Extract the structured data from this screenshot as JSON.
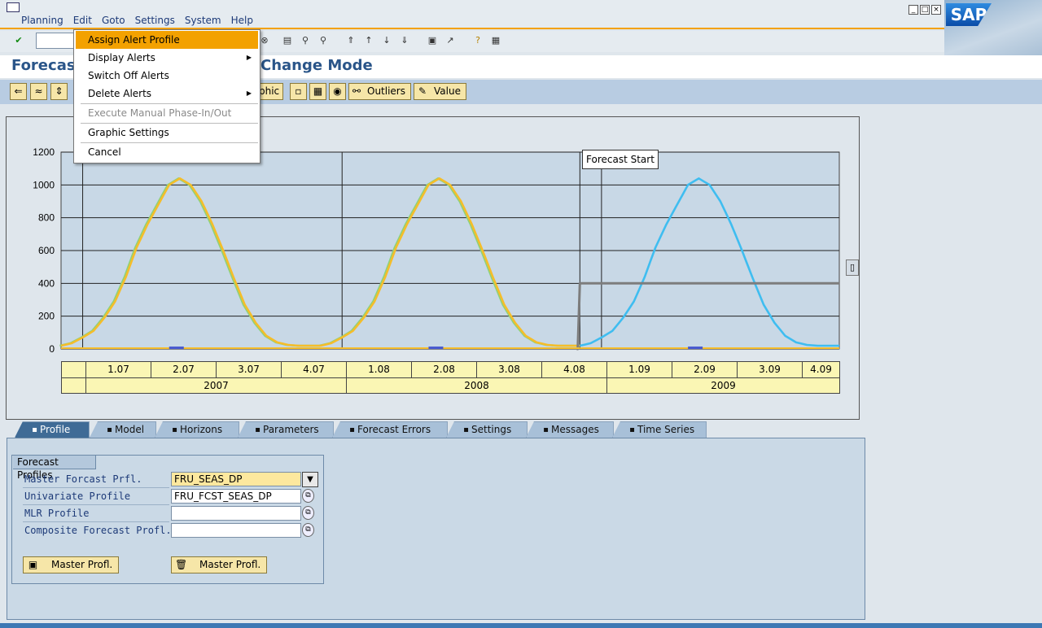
{
  "menubar": {
    "items": [
      "Planning",
      "Edit",
      "Goto",
      "Settings",
      "System",
      "Help"
    ],
    "active": "Edit"
  },
  "sap_logo": "SAP",
  "title": {
    "left": "Forecas",
    "right": "Change Mode"
  },
  "app_toolbar": {
    "graphic_partial": "phic",
    "outliers": "Outliers",
    "value": "Value"
  },
  "edit_menu": {
    "items": [
      {
        "label": "Assign Alert Profile",
        "state": "highlighted"
      },
      {
        "label": "Display Alerts",
        "submenu": true
      },
      {
        "label": "Switch Off Alerts"
      },
      {
        "label": "Delete Alerts",
        "submenu": true
      },
      {
        "label": "Execute Manual Phase-In/Out",
        "state": "disabled"
      },
      {
        "label": "Graphic Settings"
      },
      {
        "label": "Cancel"
      }
    ]
  },
  "chart_data": {
    "type": "line",
    "y_ticks": [
      "0",
      "200",
      "400",
      "600",
      "800",
      "1000",
      "1200"
    ],
    "ylim": [
      0,
      1200
    ],
    "x_start": 0,
    "x_end": 36,
    "forecast_start_label": "Forecast Start",
    "quarter_labels": [
      "1.07",
      "2.07",
      "3.07",
      "4.07",
      "1.08",
      "2.08",
      "3.08",
      "4.08",
      "1.09",
      "2.09",
      "3.09",
      "4.09"
    ],
    "year_labels": [
      "2007",
      "2008",
      "2009"
    ],
    "cycle_profile": [
      20,
      35,
      70,
      110,
      190,
      290,
      440,
      620,
      760,
      880,
      1000,
      1040,
      1000,
      900,
      760,
      600,
      430,
      270,
      160,
      80,
      40,
      25,
      20,
      20
    ],
    "series": [
      {
        "color": "#8cd27a",
        "from": 0,
        "to": 24,
        "role": "history"
      },
      {
        "color": "#f5bd2a",
        "from": 0,
        "to": 24,
        "role": "history"
      },
      {
        "color": "#3fbdf0",
        "from": 24,
        "to": 36,
        "role": "forecast"
      },
      {
        "color": "#7d7d7d",
        "role": "baseline",
        "value": 400,
        "from": 24
      }
    ],
    "grid": true
  },
  "tabs": [
    {
      "label": "Profile",
      "icon": "profile-icon",
      "active": true
    },
    {
      "label": "Model",
      "icon": "model-icon"
    },
    {
      "label": "Horizons",
      "icon": "calendar-icon"
    },
    {
      "label": "Parameters",
      "icon": "parameters-icon"
    },
    {
      "label": "Forecast Errors",
      "icon": "forecast-errors-icon"
    },
    {
      "label": "Settings",
      "icon": "settings-icon"
    },
    {
      "label": "Messages",
      "icon": "messages-icon"
    },
    {
      "label": "Time Series",
      "icon": "time-series-icon"
    }
  ],
  "forecast_profiles": {
    "group_title": "Forecast Profiles",
    "fields": [
      {
        "label": "Master Forcast Prfl.",
        "value": "FRU_SEAS_DP"
      },
      {
        "label": "Univariate Profile",
        "value": "FRU_FCST_SEAS_DP"
      },
      {
        "label": "MLR Profile",
        "value": ""
      },
      {
        "label": "Composite Forecast Profl.",
        "value": ""
      }
    ],
    "save_button": "Master Profl.",
    "delete_button": "Master Profl."
  }
}
